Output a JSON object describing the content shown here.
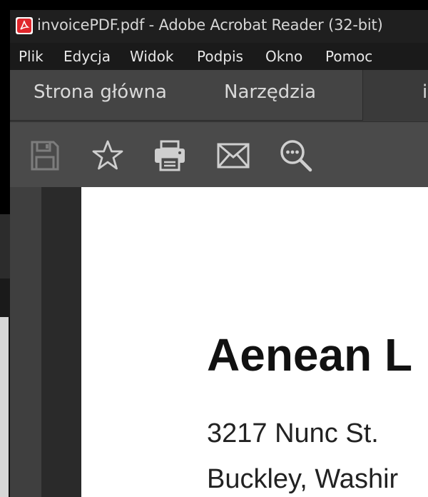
{
  "window": {
    "title": "invoicePDF.pdf - Adobe Acrobat Reader (32-bit)",
    "app_icon": "acrobat-logo-icon"
  },
  "menu": [
    "Plik",
    "Edycja",
    "Widok",
    "Podpis",
    "Okno",
    "Pomoc"
  ],
  "tabs": {
    "home": "Strona główna",
    "tools": "Narzędzia",
    "doc_partial": "i"
  },
  "toolbar": {
    "buttons": [
      "save-icon",
      "bookmark-star-icon",
      "print-icon",
      "email-icon",
      "search-more-icon"
    ]
  },
  "document": {
    "company": "Aenean L",
    "street": "3217 Nunc St.",
    "city": "Buckley, Washir"
  },
  "colors": {
    "titlebar": "#1f1f1f",
    "menubar": "#1a1a1a",
    "tabbar": "#444444",
    "toolbar": "#4a4a4a",
    "page": "#ffffff",
    "acrobat_red": "#e0262b"
  }
}
